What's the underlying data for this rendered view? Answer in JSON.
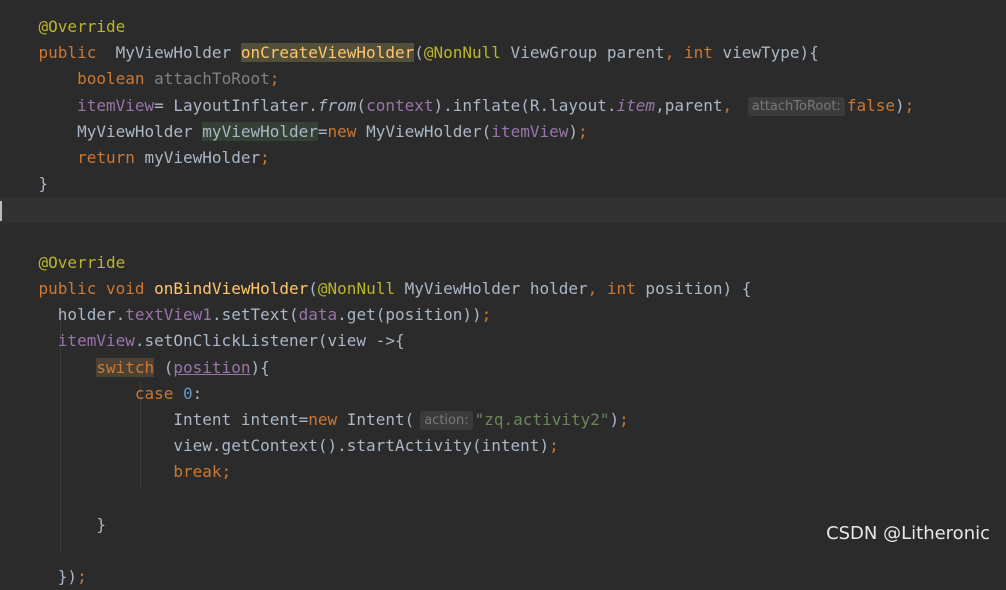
{
  "watermark": "CSDN @Litheronic",
  "code": {
    "lines": [
      [
        {
          "text": "    "
        },
        {
          "text": "@Override",
          "cls": "ann"
        }
      ],
      [
        {
          "text": "    "
        },
        {
          "text": "public",
          "cls": "kw"
        },
        {
          "text": "  MyViewHolder "
        },
        {
          "text": "onCreateViewHolder",
          "cls": "fn hl-fn"
        },
        {
          "text": "("
        },
        {
          "text": "@NonNull",
          "cls": "ann"
        },
        {
          "text": " ViewGroup parent"
        },
        {
          "text": ", ",
          "cls": "kw"
        },
        {
          "text": "int",
          "cls": "kw"
        },
        {
          "text": " viewType){"
        }
      ],
      [
        {
          "text": "        "
        },
        {
          "text": "boolean",
          "cls": "kw"
        },
        {
          "text": " attachToRoot",
          "cls": "unused"
        },
        {
          "text": ";",
          "cls": "kw"
        }
      ],
      [
        {
          "text": "        "
        },
        {
          "text": "itemView",
          "cls": "fld"
        },
        {
          "text": "= LayoutInflater."
        },
        {
          "text": "from",
          "cls": "italic"
        },
        {
          "text": "("
        },
        {
          "text": "context",
          "cls": "fld"
        },
        {
          "text": ").inflate(R.layout."
        },
        {
          "text": "item",
          "cls": "fld italic"
        },
        {
          "text": ","
        },
        {
          "text": "parent"
        },
        {
          "text": ", ",
          "cls": "kw"
        },
        {
          "text": "attachToRoot:",
          "cls": "hint"
        },
        {
          "text": "false",
          "cls": "kw"
        },
        {
          "text": ")"
        },
        {
          "text": ";",
          "cls": "kw"
        }
      ],
      [
        {
          "text": "        MyViewHolder "
        },
        {
          "text": "myViewHolder",
          "cls": "hl-ident"
        },
        {
          "text": "="
        },
        {
          "text": "new",
          "cls": "kw"
        },
        {
          "text": " MyViewHolder("
        },
        {
          "text": "itemView",
          "cls": "fld"
        },
        {
          "text": ")"
        },
        {
          "text": ";",
          "cls": "kw"
        }
      ],
      [
        {
          "text": "        "
        },
        {
          "text": "return",
          "cls": "kw"
        },
        {
          "text": " myViewHolder"
        },
        {
          "text": ";",
          "cls": "kw"
        }
      ],
      [
        {
          "text": "    }"
        }
      ],
      [],
      [],
      [
        {
          "text": "    "
        },
        {
          "text": "@Override",
          "cls": "ann"
        }
      ],
      [
        {
          "text": "    "
        },
        {
          "text": "public",
          "cls": "kw"
        },
        {
          "text": " "
        },
        {
          "text": "void",
          "cls": "kw"
        },
        {
          "text": " "
        },
        {
          "text": "onBindViewHolder",
          "cls": "fn"
        },
        {
          "text": "("
        },
        {
          "text": "@NonNull",
          "cls": "ann"
        },
        {
          "text": " MyViewHolder holder"
        },
        {
          "text": ", ",
          "cls": "kw"
        },
        {
          "text": "int",
          "cls": "kw"
        },
        {
          "text": " position) {"
        }
      ],
      [
        {
          "text": "      holder."
        },
        {
          "text": "textView1",
          "cls": "fld"
        },
        {
          "text": ".setText("
        },
        {
          "text": "data",
          "cls": "fld"
        },
        {
          "text": ".get(position))"
        },
        {
          "text": ";",
          "cls": "kw"
        }
      ],
      [
        {
          "text": "      "
        },
        {
          "text": "itemView",
          "cls": "fld"
        },
        {
          "text": ".setOnClickListener(view ->{"
        }
      ],
      [
        {
          "text": "          "
        },
        {
          "text": "switch",
          "cls": "kw hl-kw"
        },
        {
          "text": " ("
        },
        {
          "text": "position",
          "cls": "fld ul"
        },
        {
          "text": "){"
        }
      ],
      [
        {
          "text": "              "
        },
        {
          "text": "case",
          "cls": "kw"
        },
        {
          "text": " "
        },
        {
          "text": "0",
          "cls": "num"
        },
        {
          "text": ":"
        }
      ],
      [
        {
          "text": "                  Intent intent="
        },
        {
          "text": "new",
          "cls": "kw"
        },
        {
          "text": " Intent("
        },
        {
          "text": "action:",
          "cls": "hint"
        },
        {
          "text": "\"zq.activity2\"",
          "cls": "str"
        },
        {
          "text": ")"
        },
        {
          "text": ";",
          "cls": "kw"
        }
      ],
      [
        {
          "text": "                  view.getContext().startActivity(intent)"
        },
        {
          "text": ";",
          "cls": "kw"
        }
      ],
      [
        {
          "text": "                  "
        },
        {
          "text": "break;",
          "cls": "kw"
        }
      ],
      [],
      [
        {
          "text": "          }"
        }
      ],
      [],
      [
        {
          "text": "      })"
        },
        {
          "text": ";",
          "cls": "kw"
        }
      ]
    ]
  }
}
